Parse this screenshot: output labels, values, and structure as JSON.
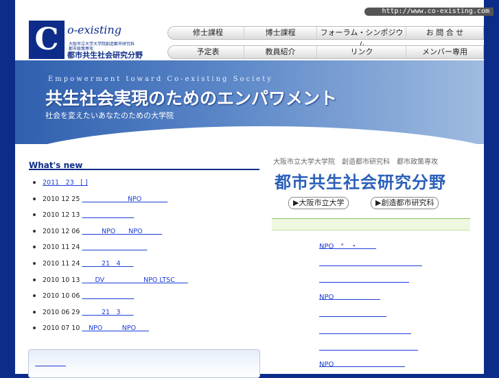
{
  "header": {
    "url": "http://www.co-existing.com"
  },
  "logo": {
    "letter": "C",
    "wordmark": "o-existing",
    "sub1": "大阪市立大学大学院創造都市研究科",
    "sub2": "都市政策専攻",
    "name": "都市共生社会研究分野"
  },
  "nav": {
    "row1": [
      "修士課程",
      "博士課程",
      "フォーラム・シンポジウム",
      "お 問 合 せ"
    ],
    "row2": [
      "予定表",
      "教員紹介",
      "リンク",
      "メンバー専用"
    ]
  },
  "banner": {
    "english": "Empowerment toward Co-existing Society",
    "japanese": "共生社会実現のためのエンパワメント",
    "subtitle": "社会を変えたいあなたのための大学院"
  },
  "news": {
    "heading": "What's new",
    "items": [
      {
        "date": "",
        "link": "2011　23　[ ]"
      },
      {
        "date": "2010 12 25",
        "link": "　　　　　　　NPO　　　　"
      },
      {
        "date": "2010 12 13",
        "link": "　　　　　　　　"
      },
      {
        "date": "2010 12 06",
        "link": "　　　NPO　　NPO　　　"
      },
      {
        "date": "2010 11 24",
        "link": "　　　　　　　　　　"
      },
      {
        "date": "2010 11 24",
        "link": "　　　21　4　　"
      },
      {
        "date": "2010 10 13",
        "link": "　　DV　　　　　　NPO LTSC　　"
      },
      {
        "date": "2010 10 06",
        "link": "　　　　　　　　"
      },
      {
        "date": "2010 06 29",
        "link": "　　　21　3　　"
      },
      {
        "date": "2010 07 10",
        "link": "　NPO　　　NPO　　"
      }
    ],
    "box_link": "　　　　　"
  },
  "right": {
    "institution": "大阪市立大学大学院　創造都市研究科　都市政策専攻",
    "title": "都市共生社会研究分野",
    "buttons": [
      "▶大阪市立大学",
      "▶創造都市研究科"
    ],
    "links": [
      "NPO　\"　・　",
      "　　　　　　　　　　　",
      "　　　　　　　　　　",
      "NPO　　　　",
      "　　　　　　　　",
      "　　　　　　　　",
      "　　　　　　　　　",
      "NPO　　　　　"
    ]
  }
}
